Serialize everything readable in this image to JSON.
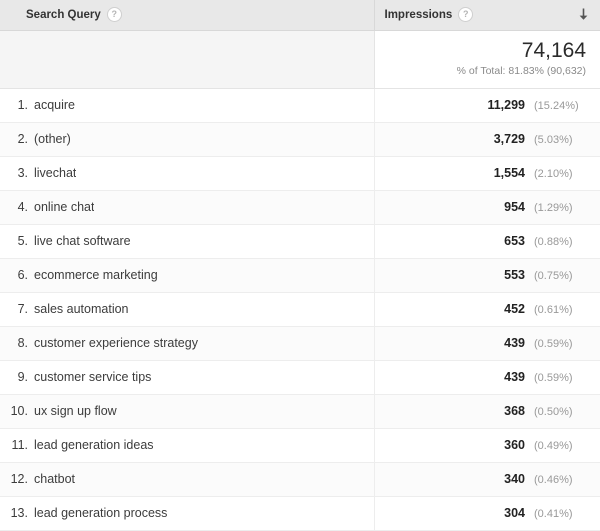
{
  "table": {
    "columns": [
      {
        "key": "search_query",
        "label": "Search Query",
        "help_icon": "help-icon",
        "help_glyph": "?"
      },
      {
        "key": "impressions",
        "label": "Impressions",
        "help_icon": "help-icon",
        "help_glyph": "?",
        "sort_icon": "sort-descending-arrow-icon",
        "sort_direction": "descending"
      }
    ],
    "summary": {
      "value": "74,164",
      "subtext": "% of Total: 81.83% (90,632)"
    },
    "rows": [
      {
        "rank": "1.",
        "query": "acquire",
        "value": "11,299",
        "pct": "(15.24%)"
      },
      {
        "rank": "2.",
        "query": "(other)",
        "value": "3,729",
        "pct": "(5.03%)"
      },
      {
        "rank": "3.",
        "query": "livechat",
        "value": "1,554",
        "pct": "(2.10%)"
      },
      {
        "rank": "4.",
        "query": "online chat",
        "value": "954",
        "pct": "(1.29%)"
      },
      {
        "rank": "5.",
        "query": "live chat software",
        "value": "653",
        "pct": "(0.88%)"
      },
      {
        "rank": "6.",
        "query": "ecommerce marketing",
        "value": "553",
        "pct": "(0.75%)"
      },
      {
        "rank": "7.",
        "query": "sales automation",
        "value": "452",
        "pct": "(0.61%)"
      },
      {
        "rank": "8.",
        "query": "customer experience strategy",
        "value": "439",
        "pct": "(0.59%)"
      },
      {
        "rank": "9.",
        "query": "customer service tips",
        "value": "439",
        "pct": "(0.59%)"
      },
      {
        "rank": "10.",
        "query": "ux sign up flow",
        "value": "368",
        "pct": "(0.50%)"
      },
      {
        "rank": "11.",
        "query": "lead generation ideas",
        "value": "360",
        "pct": "(0.49%)"
      },
      {
        "rank": "12.",
        "query": "chatbot",
        "value": "340",
        "pct": "(0.46%)"
      },
      {
        "rank": "13.",
        "query": "lead generation process",
        "value": "304",
        "pct": "(0.41%)"
      }
    ]
  },
  "colors": {
    "header_background": "#e8e8e8",
    "summary_background": "#f5f5f5",
    "row_background": "#ffffff",
    "row_border": "#ededed",
    "muted_text": "#999999",
    "primary_text": "#3c3c3c"
  }
}
